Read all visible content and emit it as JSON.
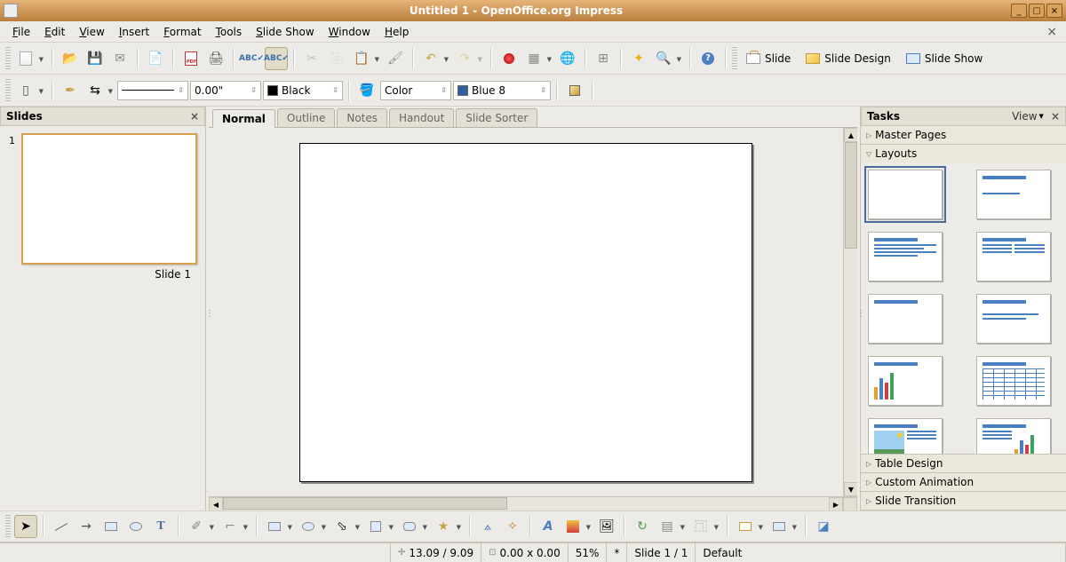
{
  "window": {
    "title": "Untitled 1 - OpenOffice.org Impress"
  },
  "menu": [
    "File",
    "Edit",
    "View",
    "Insert",
    "Format",
    "Tools",
    "Slide Show",
    "Window",
    "Help"
  ],
  "toolbar_right": {
    "slide": "Slide",
    "slide_design": "Slide Design",
    "slide_show": "Slide Show"
  },
  "line_toolbar": {
    "width": "0.00\"",
    "color_label": "Black",
    "area_label": "Color",
    "fill_label": "Blue 8"
  },
  "slides_panel": {
    "title": "Slides",
    "items": [
      {
        "num": "1",
        "label": "Slide 1"
      }
    ]
  },
  "view_tabs": [
    "Normal",
    "Outline",
    "Notes",
    "Handout",
    "Slide Sorter"
  ],
  "tasks_panel": {
    "title": "Tasks",
    "view": "View",
    "sections": {
      "master": "Master Pages",
      "layouts": "Layouts",
      "table": "Table Design",
      "anim": "Custom Animation",
      "trans": "Slide Transition"
    }
  },
  "status": {
    "pos": "13.09 / 9.09",
    "size": "0.00 x 0.00",
    "zoom": "51%",
    "mod": "*",
    "page": "Slide 1 / 1",
    "template": "Default"
  }
}
